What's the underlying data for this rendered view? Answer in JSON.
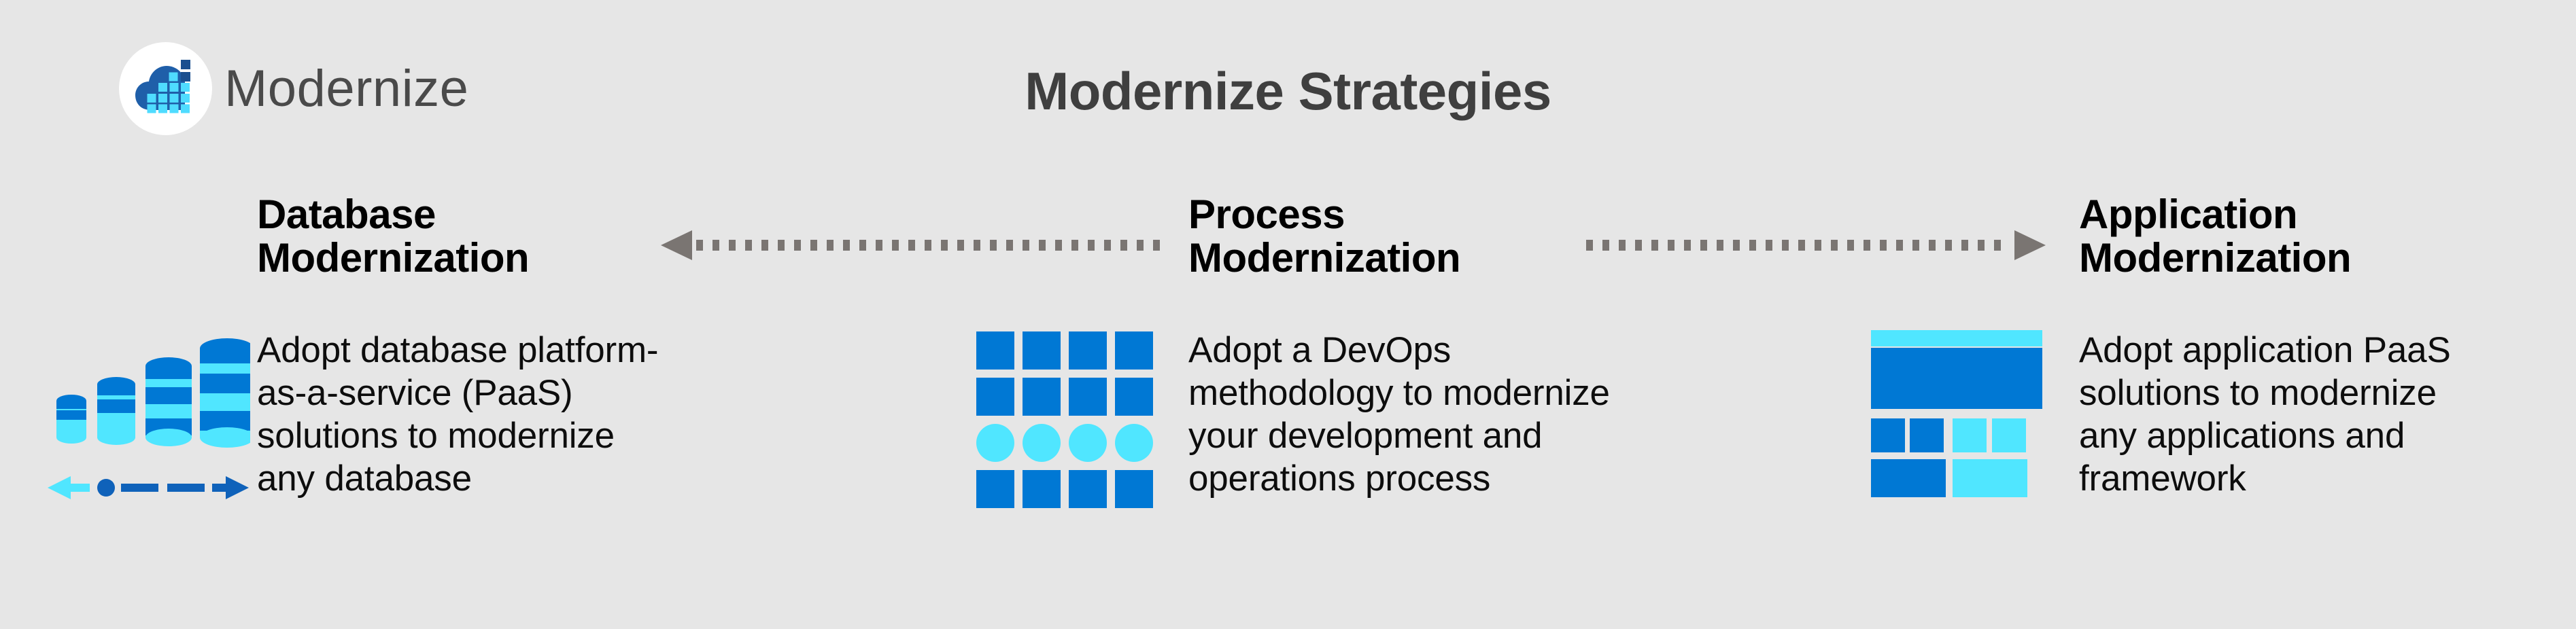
{
  "brand": {
    "wordmark": "Modernize",
    "logo_icon": "cloud-blocks-icon",
    "badge_color": "#ffffff",
    "cloud_color": "#1f5fa9",
    "block_color": "#4fdcff",
    "dark_block_color": "#1b4f8f"
  },
  "title": "Modernize Strategies",
  "theme": {
    "background": "#e6e6e6",
    "title_color": "#3f3f3f",
    "heading_color": "#000000",
    "body_color": "#0d0d0d",
    "wordmark_color": "#4a4a4a",
    "arrow_color": "#7a7572",
    "accent_blue": "#0078d4",
    "accent_cyan": "#50e6ff",
    "accent_deep_blue": "#1063b8"
  },
  "columns": [
    {
      "id": "database",
      "heading": "Database\nModernization",
      "body": "Adopt database platform-\nas-a-service (PaaS)\nsolutions to modernize\nany database",
      "icon": "database-growth-icon"
    },
    {
      "id": "process",
      "heading": "Process\nModernization",
      "body": "Adopt a DevOps\nmethodology to modernize\nyour development and\noperations process",
      "icon": "devops-grid-icon"
    },
    {
      "id": "application",
      "heading": "Application\nModernization",
      "body": "Adopt application PaaS\nsolutions to modernize\nany applications and\nframework",
      "icon": "app-wireframe-icon"
    }
  ],
  "connectors": [
    {
      "id": "left",
      "icon": "dotted-arrow-left-icon",
      "direction": "left"
    },
    {
      "id": "right",
      "icon": "dotted-arrow-right-icon",
      "direction": "right"
    }
  ]
}
